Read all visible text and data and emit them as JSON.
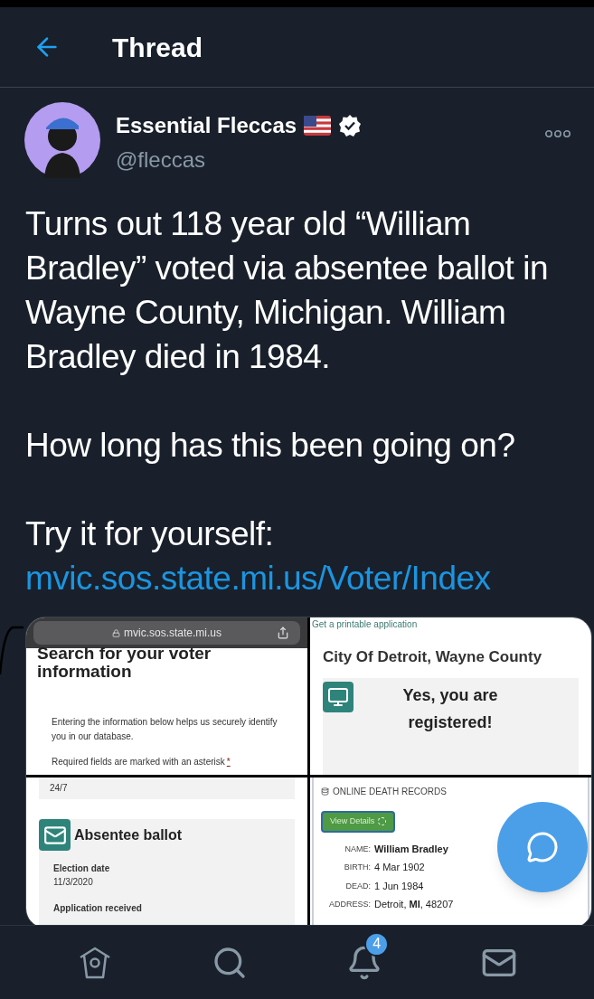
{
  "header": {
    "title": "Thread"
  },
  "tweet": {
    "name": "Essential Fleccas",
    "handle": "@fleccas",
    "verified": true,
    "paragraphs": [
      "Turns out 118 year old “William Bradley” voted via absentee ballot in Wayne County, Michigan. William Bradley died in 1984.",
      "How long has this been going on?",
      "Try it for yourself:"
    ],
    "link": "mvic.sos.state.mi.us/Voter/Index"
  },
  "media": {
    "panels": [
      {
        "kind": "voter-search",
        "url": "mvic.sos.state.mi.us",
        "heading": "Search for your voter information",
        "intro": "Entering the information below helps us securely identify you in our database.",
        "required": "Required fields are marked with an asterisk",
        "asterisk": "*"
      },
      {
        "kind": "registration",
        "link": "Get a printable application",
        "heading": "City Of Detroit, Wayne County",
        "status": "Yes, you are registered!"
      },
      {
        "kind": "absentee",
        "hours": "24/7",
        "heading": "Absentee ballot",
        "fields": [
          {
            "label": "Election date",
            "value": "11/3/2020"
          }
        ],
        "next": "Application received"
      },
      {
        "kind": "death-index",
        "source": "ONLINE DEATH RECORDS",
        "button": "View Details",
        "records": [
          {
            "label": "NAME:",
            "value": "William Bradley",
            "bold": true
          },
          {
            "label": "BIRTH:",
            "value": "4 Mar 1902",
            "bold": false
          },
          {
            "label": "DEAD:",
            "value": "1 Jun 1984",
            "bold": false
          },
          {
            "label": "ADDRESS:",
            "value": "Detroit, **MI**, 48207",
            "bold": false
          }
        ]
      }
    ]
  },
  "nav": [
    {
      "kind": "home"
    },
    {
      "kind": "search"
    },
    {
      "kind": "notifications",
      "badge": "4"
    },
    {
      "kind": "messages"
    }
  ]
}
